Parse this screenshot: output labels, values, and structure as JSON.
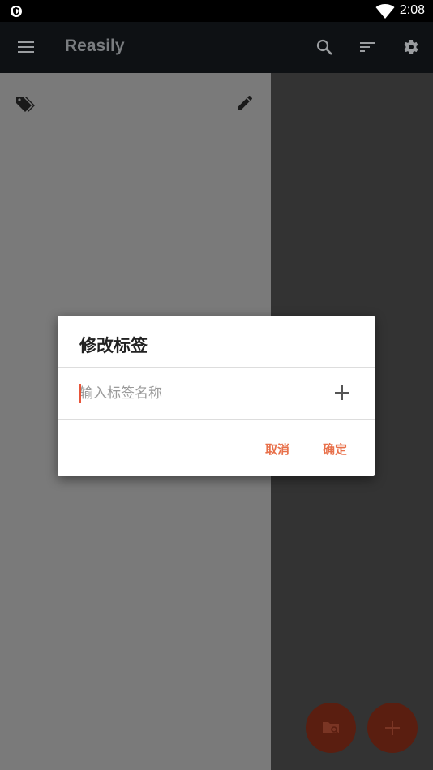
{
  "status_bar": {
    "time": "2:08"
  },
  "app_bar": {
    "title": "Reasily"
  },
  "dialog": {
    "title": "修改标签",
    "input_placeholder": "输入标签名称",
    "input_value": "",
    "cancel_label": "取消",
    "confirm_label": "确定"
  },
  "colors": {
    "accent": "#e8704a",
    "app_bar": "#0e1114",
    "drawer": "#7a7a7a"
  }
}
